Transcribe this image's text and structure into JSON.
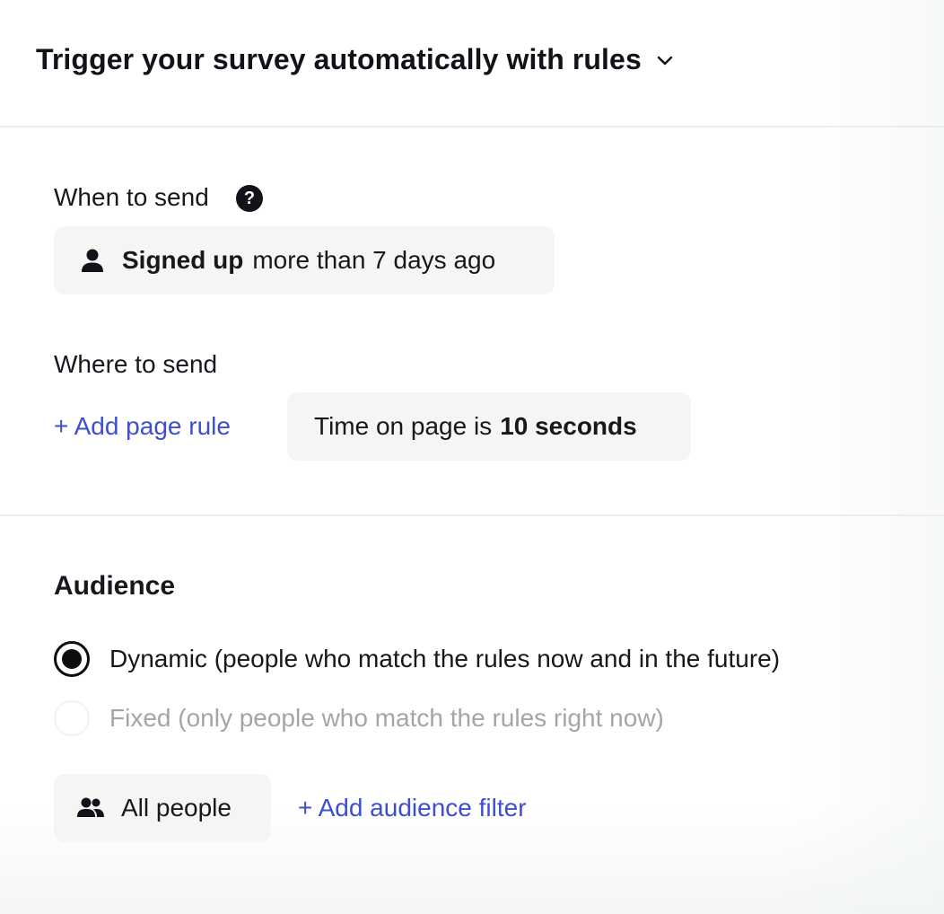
{
  "header": {
    "title": "Trigger your survey automatically with rules",
    "toggle_icon": "chevron-down-icon"
  },
  "when_to_send": {
    "label": "When to send",
    "help_icon": "question-circle-icon",
    "help_glyph": "?",
    "rule": {
      "icon": "person-icon",
      "attribute": "Signed up",
      "condition": "more than 7 days ago"
    }
  },
  "where_to_send": {
    "label": "Where to send",
    "add_rule_link": "+ Add page rule",
    "rule": {
      "prefix": "Time on page is",
      "value": "10 seconds"
    }
  },
  "audience": {
    "title": "Audience",
    "options": [
      {
        "label": "Dynamic (people who match the rules now and in the future)",
        "selected": true
      },
      {
        "label": "Fixed (only people who match the rules right now)",
        "selected": false
      }
    ],
    "segment": {
      "icon": "people-icon",
      "label": "All people"
    },
    "add_filter_link": "+ Add audience filter"
  },
  "colors": {
    "link": "#3d4fcf",
    "chip_bg": "#f5f5f4",
    "text": "#16181d",
    "muted": "#a3a5a8"
  }
}
